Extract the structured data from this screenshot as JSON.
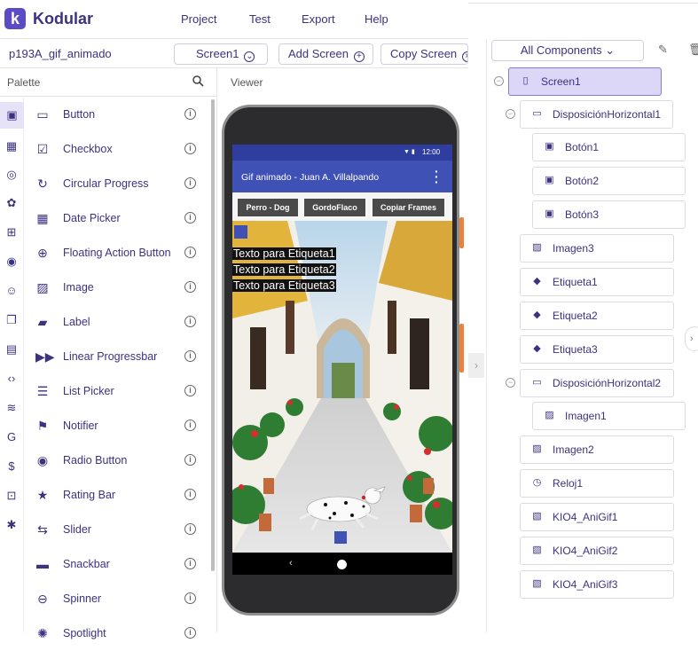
{
  "app": {
    "logo_letter": "k",
    "title": "Kodular"
  },
  "menu": [
    "Project",
    "Test",
    "Export",
    "Help"
  ],
  "project": {
    "name": "p193A_gif_animado",
    "screen_select": "Screen1",
    "add_screen": "Add Screen",
    "copy_screen": "Copy Screen"
  },
  "palette": {
    "title": "Palette",
    "components": [
      "Button",
      "Checkbox",
      "Circular Progress",
      "Date Picker",
      "Floating Action Button",
      "Image",
      "Label",
      "Linear Progressbar",
      "List Picker",
      "Notifier",
      "Radio Button",
      "Rating Bar",
      "Slider",
      "Snackbar",
      "Spinner",
      "Spotlight"
    ],
    "icons": [
      "button-icon",
      "checkbox-icon",
      "circular-progress-icon",
      "date-picker-icon",
      "fab-icon",
      "image-icon",
      "label-icon",
      "linear-progress-icon",
      "list-picker-icon",
      "notifier-icon",
      "radio-button-icon",
      "rating-bar-icon",
      "slider-icon",
      "snackbar-icon",
      "spinner-icon",
      "spotlight-icon"
    ]
  },
  "viewer": {
    "title": "Viewer",
    "status_time": "12:00",
    "app_title": "Gif animado - Juan A. Villalpando",
    "buttons": [
      "Perro - Dog",
      "GordoFlaco",
      "Copiar Frames"
    ],
    "labels": [
      "Texto para Etiqueta1",
      "Texto para Etiqueta2",
      "Texto para Etiqueta3"
    ]
  },
  "tree": {
    "dropdown": "All Components",
    "nodes": [
      "Screen1",
      "DisposiciónHorizontal1",
      "Botón1",
      "Botón2",
      "Botón3",
      "Imagen3",
      "Etiqueta1",
      "Etiqueta2",
      "Etiqueta3",
      "DisposiciónHorizontal2",
      "Imagen1",
      "Imagen2",
      "Reloj1",
      "KIO4_AniGif1",
      "KIO4_AniGif2",
      "KIO4_AniGif3"
    ]
  },
  "colors": {
    "accent": "#3b3280",
    "brand": "#5b4bc4",
    "appbar": "#3f51b5",
    "selected": "#dcd6f7"
  }
}
